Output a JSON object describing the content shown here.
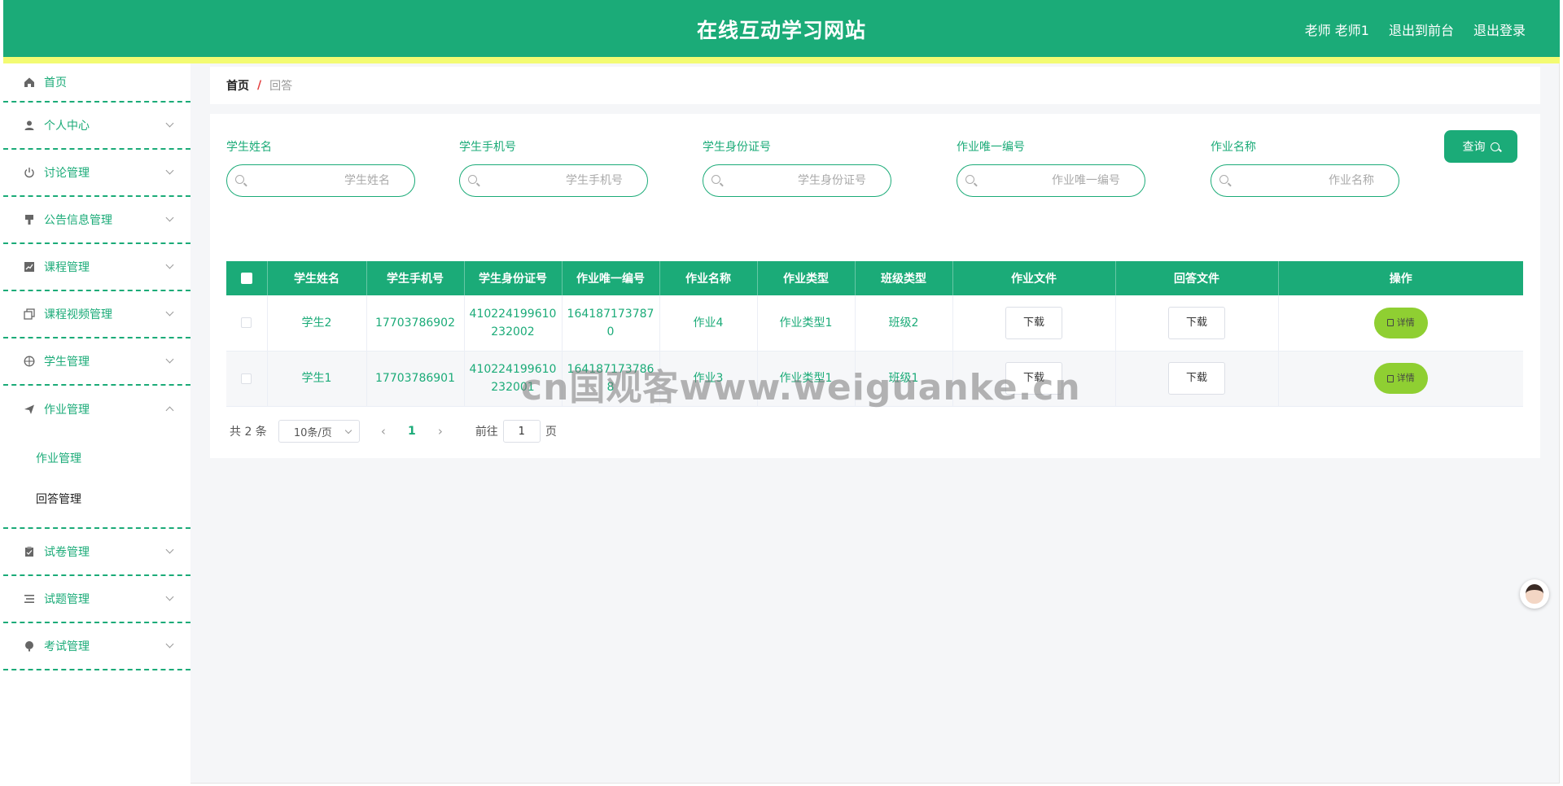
{
  "header": {
    "title": "在线互动学习网站",
    "user": "老师 老师1",
    "links": [
      "退出到前台",
      "退出登录"
    ]
  },
  "sidebar": {
    "items": [
      {
        "label": "首页",
        "icon": "home-icon"
      },
      {
        "label": "个人中心",
        "icon": "user-icon"
      },
      {
        "label": "讨论管理",
        "icon": "power-icon"
      },
      {
        "label": "公告信息管理",
        "icon": "brush-icon"
      },
      {
        "label": "课程管理",
        "icon": "chart-icon"
      },
      {
        "label": "课程视频管理",
        "icon": "copy-icon"
      },
      {
        "label": "学生管理",
        "icon": "basketball-icon"
      },
      {
        "label": "作业管理",
        "icon": "send-icon"
      },
      {
        "label": "试卷管理",
        "icon": "clipboard-icon"
      },
      {
        "label": "试题管理",
        "icon": "list-icon"
      },
      {
        "label": "考试管理",
        "icon": "globe-icon"
      }
    ],
    "submenu": [
      "作业管理",
      "回答管理"
    ]
  },
  "breadcrumb": {
    "home": "首页",
    "separator": "/",
    "current": "回答"
  },
  "search": {
    "fields": [
      {
        "label": "学生姓名",
        "placeholder": "学生姓名"
      },
      {
        "label": "学生手机号",
        "placeholder": "学生手机号"
      },
      {
        "label": "学生身份证号",
        "placeholder": "学生身份证号"
      },
      {
        "label": "作业唯一编号",
        "placeholder": "作业唯一编号"
      },
      {
        "label": "作业名称",
        "placeholder": "作业名称"
      }
    ],
    "query_label": "查询"
  },
  "table": {
    "headers": [
      "学生姓名",
      "学生手机号",
      "学生身份证号",
      "作业唯一编号",
      "作业名称",
      "作业类型",
      "班级类型",
      "作业文件",
      "回答文件",
      "操作"
    ],
    "rows": [
      {
        "name": "学生2",
        "phone": "17703786902",
        "id_card": "410224199610232002",
        "hw_id": "1641871737870",
        "hw_name": "作业4",
        "hw_type": "作业类型1",
        "class_type": "班级2",
        "hw_file": "下载",
        "answer_file": "下载",
        "action": "详情"
      },
      {
        "name": "学生1",
        "phone": "17703786901",
        "id_card": "410224199610232001",
        "hw_id": "1641871737868",
        "hw_name": "作业3",
        "hw_type": "作业类型1",
        "class_type": "班级1",
        "hw_file": "下载",
        "answer_file": "下载",
        "action": "详情"
      }
    ]
  },
  "pagination": {
    "total": "共 2 条",
    "page_size": "10条/页",
    "current_page": "1",
    "goto_label": "前往",
    "goto_value": "1",
    "goto_unit": "页"
  },
  "watermark": "cn国观客www.weiguanke.cn",
  "colors": {
    "primary": "#1bab78",
    "strip": "#f3fb72",
    "detail": "#8fcf32"
  }
}
